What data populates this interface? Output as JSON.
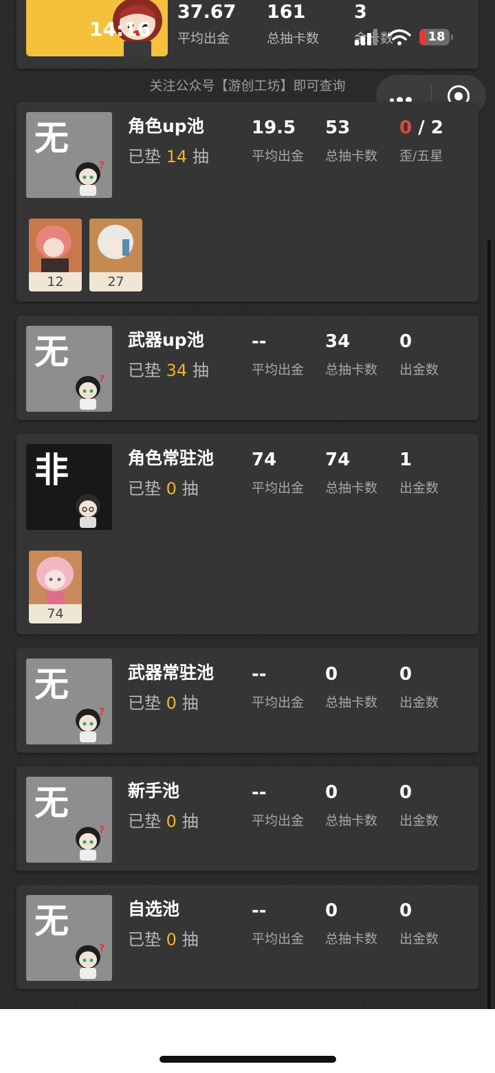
{
  "status_bar": {
    "time": "14:16",
    "battery": "18"
  },
  "summary": {
    "stats": [
      {
        "value": "37.67",
        "label": "平均出金"
      },
      {
        "value": "161",
        "label": "总抽卡数"
      },
      {
        "value": "3",
        "label": "金卡数"
      }
    ]
  },
  "notice": "关注公众号【游创工坊】即可查询",
  "pools": [
    {
      "rank": "无",
      "name": "角色up池",
      "pity_prefix": "已垫",
      "pity": "14",
      "pity_suffix": "抽",
      "stats": [
        {
          "value": "19.5",
          "label": "平均出金"
        },
        {
          "value": "53",
          "label": "总抽卡数"
        },
        {
          "value_red": "0",
          "value_rest": " / 2",
          "label": "歪/五星"
        }
      ],
      "five_stars": [
        "12",
        "27"
      ]
    },
    {
      "rank": "无",
      "name": "武器up池",
      "pity_prefix": "已垫",
      "pity": "34",
      "pity_suffix": "抽",
      "stats": [
        {
          "value": "--",
          "label": "平均出金"
        },
        {
          "value": "34",
          "label": "总抽卡数"
        },
        {
          "value": "0",
          "label": "出金数"
        }
      ]
    },
    {
      "rank": "非",
      "name": "角色常驻池",
      "pity_prefix": "已垫",
      "pity": "0",
      "pity_suffix": "抽",
      "stats": [
        {
          "value": "74",
          "label": "平均出金"
        },
        {
          "value": "74",
          "label": "总抽卡数"
        },
        {
          "value": "1",
          "label": "出金数"
        }
      ],
      "five_stars": [
        "74"
      ]
    },
    {
      "rank": "无",
      "name": "武器常驻池",
      "pity_prefix": "已垫",
      "pity": "0",
      "pity_suffix": "抽",
      "stats": [
        {
          "value": "--",
          "label": "平均出金"
        },
        {
          "value": "0",
          "label": "总抽卡数"
        },
        {
          "value": "0",
          "label": "出金数"
        }
      ]
    },
    {
      "rank": "无",
      "name": "新手池",
      "pity_prefix": "已垫",
      "pity": "0",
      "pity_suffix": "抽",
      "stats": [
        {
          "value": "--",
          "label": "平均出金"
        },
        {
          "value": "0",
          "label": "总抽卡数"
        },
        {
          "value": "0",
          "label": "出金数"
        }
      ]
    },
    {
      "rank": "无",
      "name": "自选池",
      "pity_prefix": "已垫",
      "pity": "0",
      "pity_suffix": "抽",
      "stats": [
        {
          "value": "--",
          "label": "平均出金"
        },
        {
          "value": "0",
          "label": "总抽卡数"
        },
        {
          "value": "0",
          "label": "出金数"
        }
      ]
    }
  ],
  "icons": {
    "menu": "more-dots-icon",
    "close": "target-circle-icon",
    "signal": "cell-signal-icon",
    "wifi": "wifi-icon",
    "battery": "battery-icon"
  },
  "colors": {
    "highlight": "#f0b429",
    "alert": "#e0473a",
    "card": "#353535",
    "summary_bg": "#f5c13c"
  }
}
